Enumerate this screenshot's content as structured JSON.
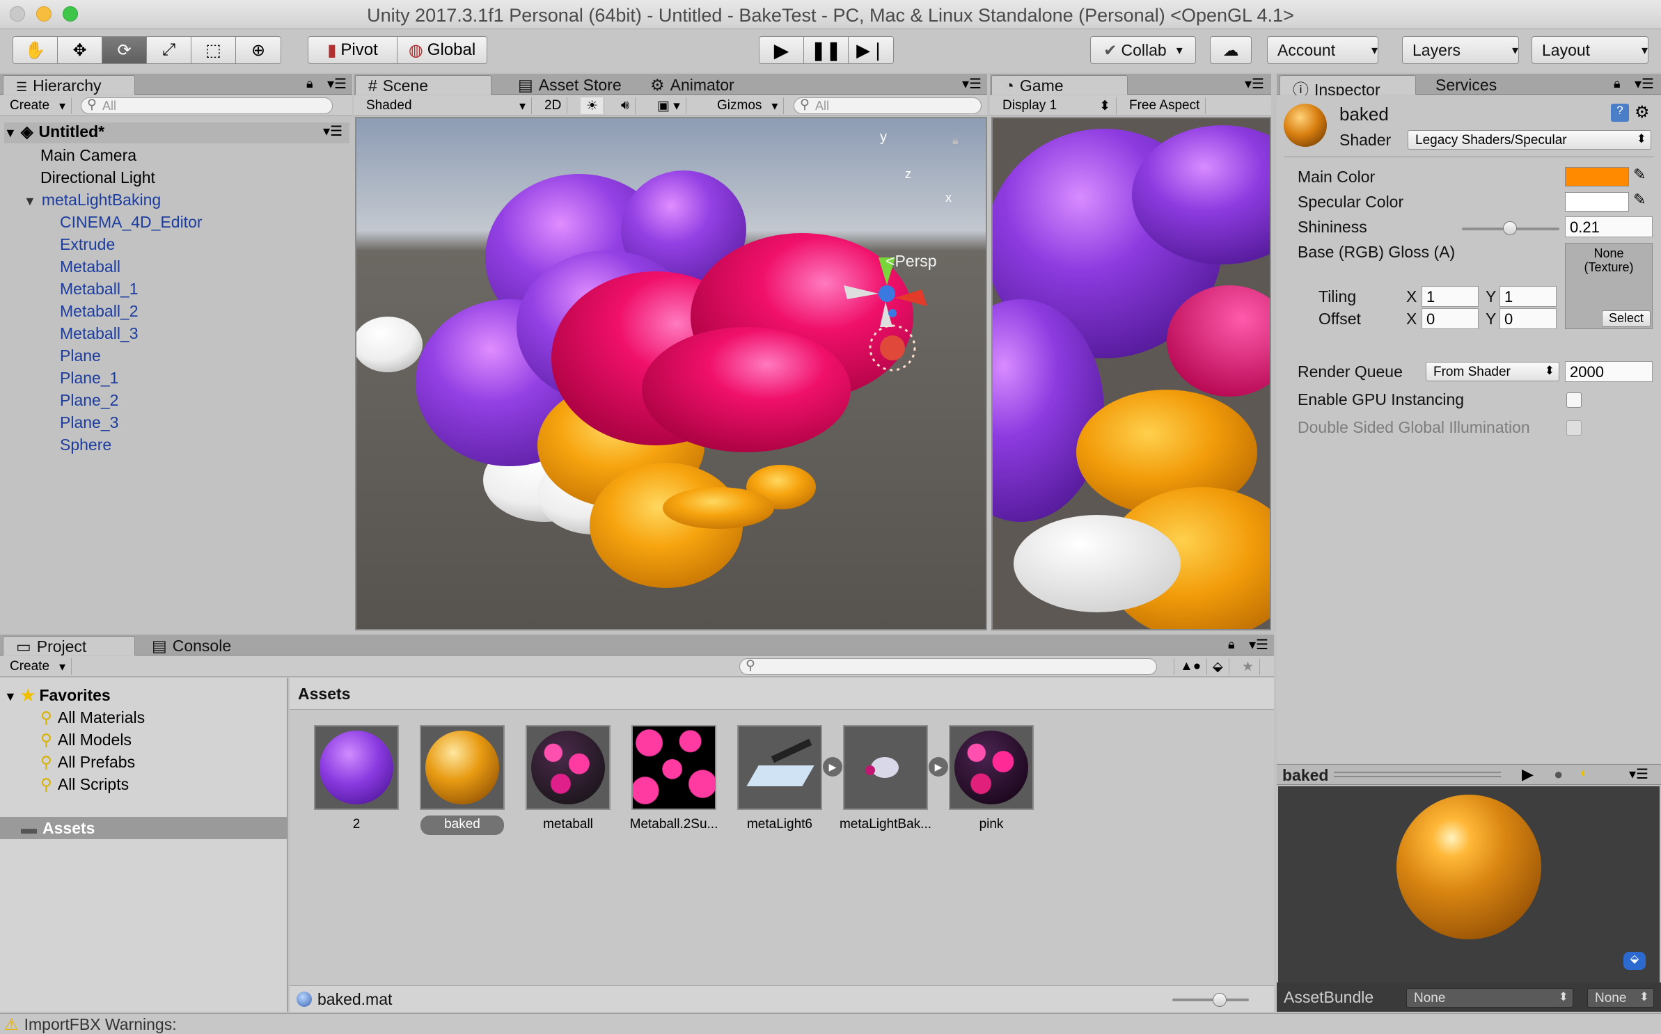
{
  "window": {
    "title": "Unity 2017.3.1f1 Personal (64bit) - Untitled - BakeTest - PC, Mac & Linux Standalone (Personal) <OpenGL 4.1>"
  },
  "toolbar": {
    "pivot": "Pivot",
    "global": "Global",
    "collab": "Collab",
    "account": "Account",
    "layers": "Layers",
    "layout": "Layout"
  },
  "hierarchy": {
    "tab": "Hierarchy",
    "create": "Create",
    "search_placeholder": "All",
    "scene_name": "Untitled*",
    "items": [
      "Main Camera",
      "Directional Light",
      "metaLightBaking"
    ],
    "children": [
      "CINEMA_4D_Editor",
      "Extrude",
      "Metaball",
      "Metaball_1",
      "Metaball_2",
      "Metaball_3",
      "Plane",
      "Plane_1",
      "Plane_2",
      "Plane_3",
      "Sphere"
    ]
  },
  "scene": {
    "tabs": [
      "Scene",
      "Asset Store",
      "Animator"
    ],
    "shading": "Shaded",
    "mode_2d": "2D",
    "gizmos": "Gizmos",
    "search_placeholder": "All",
    "persp": "Persp",
    "axis_y": "y",
    "axis_x": "x",
    "axis_z": "z"
  },
  "game": {
    "tab": "Game",
    "display": "Display 1",
    "aspect": "Free Aspect"
  },
  "inspector": {
    "tabs": [
      "Inspector",
      "Services"
    ],
    "material_name": "baked",
    "shader_label": "Shader",
    "shader_value": "Legacy Shaders/Specular",
    "main_color_label": "Main Color",
    "specular_color_label": "Specular Color",
    "shininess_label": "Shininess",
    "shininess_value": "0.21",
    "shininess_level": 0.21,
    "base_label": "Base (RGB) Gloss (A)",
    "texture_none": "None",
    "texture_type": "(Texture)",
    "select": "Select",
    "tiling_label": "Tiling",
    "offset_label": "Offset",
    "x": "X",
    "y": "Y",
    "tiling_x": "1",
    "tiling_y": "1",
    "offset_x": "0",
    "offset_y": "0",
    "render_queue_label": "Render Queue",
    "render_queue_mode": "From Shader",
    "render_queue_value": "2000",
    "gpu_instancing_label": "Enable GPU Instancing",
    "double_sided_label": "Double Sided Global Illumination",
    "main_color": "#ff8a00",
    "specular_color": "#ffffff"
  },
  "preview": {
    "title": "baked",
    "assetbundle_label": "AssetBundle",
    "assetbundle_value": "None",
    "variant_value": "None"
  },
  "project": {
    "tabs": [
      "Project",
      "Console"
    ],
    "create": "Create",
    "favorites_label": "Favorites",
    "favorites": [
      "All Materials",
      "All Models",
      "All Prefabs",
      "All Scripts"
    ],
    "assets_folder": "Assets",
    "breadcrumb": "Assets",
    "assets": [
      "2",
      "baked",
      "metaball",
      "Metaball.2Su...",
      "metaLight6",
      "metaLightBak...",
      "pink"
    ],
    "selected_file": "baked.mat"
  },
  "status": {
    "text": "ImportFBX Warnings:"
  }
}
